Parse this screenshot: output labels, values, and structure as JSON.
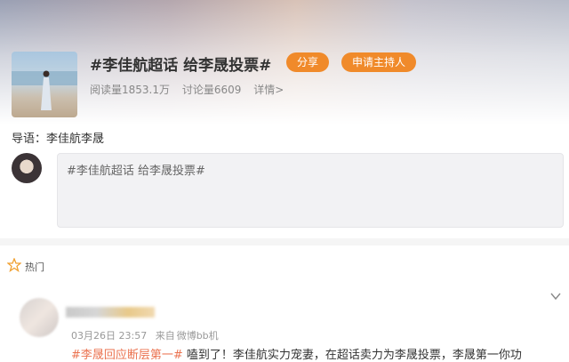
{
  "topic": {
    "title": "#李佳航超话 给李晟投票#",
    "share_label": "分享",
    "apply_host_label": "申请主持人",
    "reads": "阅读量1853.1万",
    "discussions": "讨论量6609",
    "details": "详情>"
  },
  "intro": "导语：李佳航李晟",
  "compose": {
    "text": "#李佳航超话 给李晟投票#"
  },
  "hot": {
    "label": "热门"
  },
  "post": {
    "username": "",
    "date": "03月26日 23:57",
    "source_prefix": "来自",
    "source": "微博bb机",
    "tag": "#李晟回应断层第一#",
    "body": " 嗑到了！李佳航实力宠妻，在超话卖力为李晟投票，李晟第一你功"
  },
  "colors": {
    "accent": "#f08a2a",
    "tag": "#eb7350"
  }
}
